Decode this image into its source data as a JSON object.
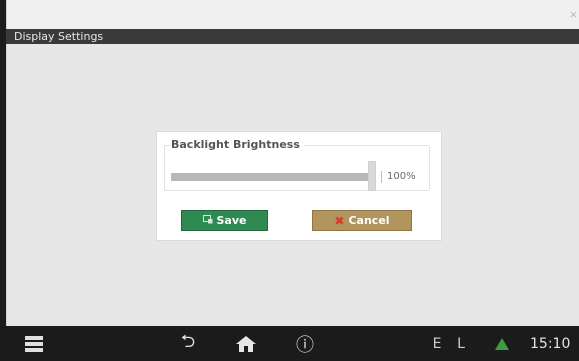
{
  "window": {
    "close_glyph": "×"
  },
  "titlebar": {
    "title": "Display Settings"
  },
  "dialog": {
    "group_label": "Backlight Brightness",
    "slider": {
      "value_text": "100%",
      "fraction": 1.0
    },
    "buttons": {
      "save_label": "Save",
      "cancel_label": "Cancel"
    }
  },
  "bottombar": {
    "icons": [
      "menu-icon",
      "back-icon",
      "home-icon",
      "info-icon",
      "warning-icon"
    ],
    "status_e": "E",
    "status_l": "L",
    "clock": "15:10"
  },
  "colors": {
    "save_button": "#2f8a52",
    "cancel_button": "#b2945e",
    "warning": "#3f9a42"
  }
}
